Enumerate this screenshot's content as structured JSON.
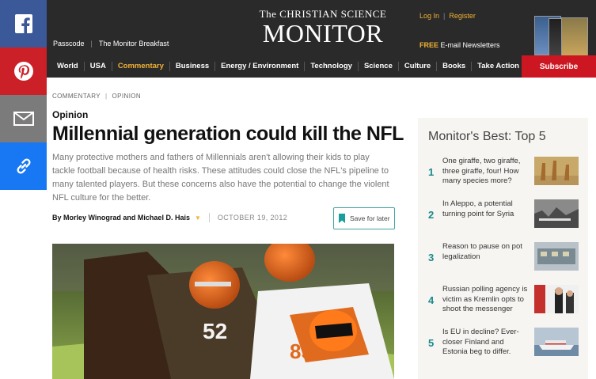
{
  "share": [
    "facebook-icon",
    "pinterest-icon",
    "email-icon",
    "link-icon"
  ],
  "header": {
    "passcode": "Passcode",
    "breakfast": "The Monitor Breakfast",
    "logo_top": "The CHRISTIAN SCIENCE",
    "logo_main": "MONITOR",
    "login": "Log In",
    "register": "Register",
    "newsletters_free": "FREE",
    "newsletters": "E-mail Newsletters"
  },
  "nav": {
    "items": [
      "World",
      "USA",
      "Commentary",
      "Business",
      "Energy / Environment",
      "Technology",
      "Science",
      "Culture",
      "Books",
      "Take Action"
    ],
    "active": "Commentary",
    "subscribe": "Subscribe"
  },
  "article": {
    "crumb1": "COMMENTARY",
    "crumb2": "OPINION",
    "section": "Opinion",
    "headline": "Millennial generation could kill the NFL",
    "dek": "Many protective mothers and fathers of Millennials aren't allowing their kids to play tackle football because of health risks. These attitudes could close the NFL's pipeline to many talented players. But these concerns also have the potential to change the violent NFL culture for the better.",
    "byline": "By Morley Winograd and Michael D. Hais",
    "date": "OCTOBER 19, 2012",
    "save": "Save for later"
  },
  "sidebar": {
    "title": "Monitor's Best: Top 5",
    "items": [
      {
        "num": "1",
        "text": "One giraffe, two giraffe, three giraffe, four! How many species more?"
      },
      {
        "num": "2",
        "text": "In Aleppo, a potential turning point for Syria"
      },
      {
        "num": "3",
        "text": "Reason to pause on pot legalization"
      },
      {
        "num": "4",
        "text": "Russian polling agency is victim as Kremlin opts to shoot the messenger"
      },
      {
        "num": "5",
        "text": "Is EU in decline? Ever-closer Finland and Estonia beg to differ."
      }
    ]
  },
  "colors": {
    "accent": "#f2b233",
    "subscribe": "#cc1722",
    "teal": "#1a8a8a"
  }
}
